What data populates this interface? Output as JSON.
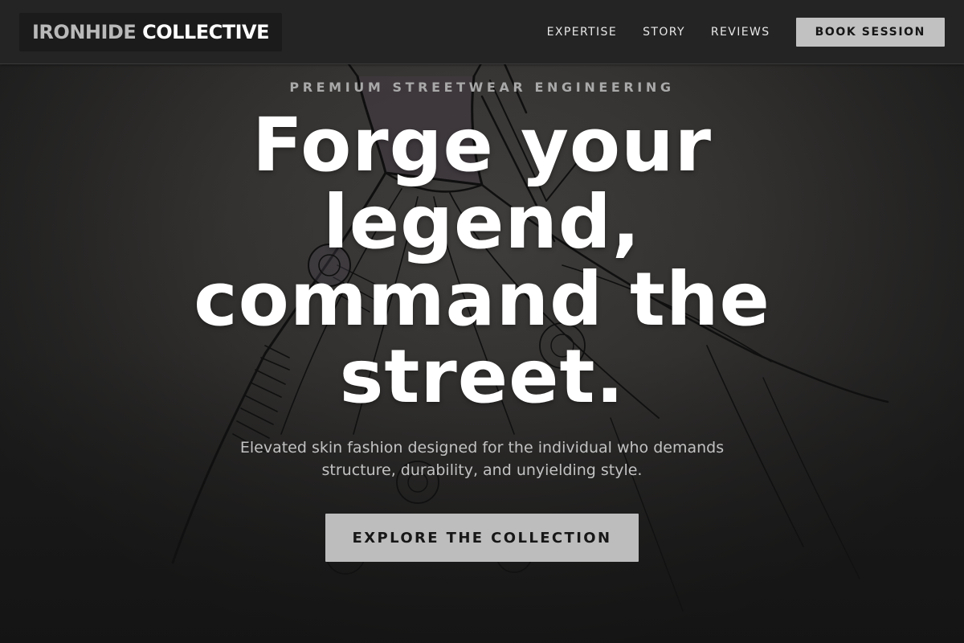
{
  "header": {
    "logo": {
      "part_1": "IRONHIDE",
      "part_2": "COLLECTIVE"
    },
    "nav": {
      "items": [
        "EXPERTISE",
        "STORY",
        "REVIEWS"
      ]
    },
    "cta_label": "BOOK SESSION"
  },
  "hero": {
    "eyebrow": "PREMIUM STREETWEAR ENGINEERING",
    "title": "Forge your legend, command the street.",
    "subtitle": "Elevated skin fashion designed for the individual who demands structure, durability, and unyielding style.",
    "cta_label": "EXPLORE THE COLLECTION",
    "background": "fashion-sketch-image"
  },
  "colors": {
    "header_bg": "#242424",
    "logo_muted": "#b9b9b9",
    "button_bg": "#c1c1c1",
    "hero_text": "#ffffff",
    "eyebrow_text": "#a9a9a9"
  }
}
